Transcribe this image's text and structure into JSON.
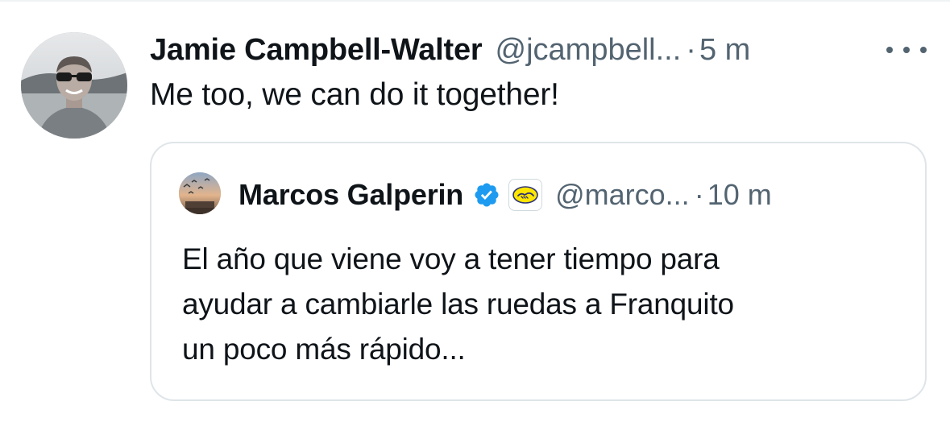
{
  "tweet": {
    "author_name": "Jamie Campbell-Walter",
    "handle": "@jcampbell...",
    "separator": "·",
    "time": "5 m",
    "text": "Me too, we can do it together!",
    "avatar_icon": "person-photo-avatar",
    "more_icon": "more-options-icon"
  },
  "quote": {
    "author_name": "Marcos Galperin",
    "handle": "@marco...",
    "separator": "·",
    "time": "10 m",
    "verified_icon": "verified-badge-icon",
    "verified_color": "#1d9bf0",
    "affiliate_icon": "handshake-affiliate-icon",
    "affiliate_color": "#ffe600",
    "text_lines": [
      "El año que viene voy a tener tiempo para",
      "ayudar a cambiarle las ruedas a Franquito",
      "un poco más rápido..."
    ]
  },
  "colors": {
    "text_primary": "#0f1419",
    "text_secondary": "#536471",
    "border": "#dfe5e8"
  }
}
